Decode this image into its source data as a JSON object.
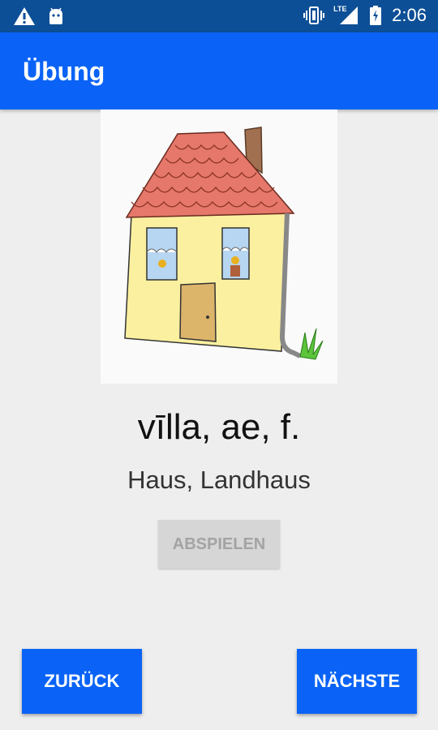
{
  "statusbar": {
    "time": "2:06",
    "network_label": "LTE",
    "icons": [
      "warning-icon",
      "android-icon",
      "vibrate-icon",
      "signal-icon",
      "battery-icon"
    ]
  },
  "appbar": {
    "title": "Übung"
  },
  "card": {
    "image": "house-illustration",
    "word": "vīlla, ae, f.",
    "meaning": "Haus, Landhaus"
  },
  "actions": {
    "play_label": "ABSPIELEN",
    "back_label": "ZURÜCK",
    "next_label": "NÄCHSTE"
  },
  "colors": {
    "primary": "#0a63f6",
    "status_bar": "#0d4f96",
    "background": "#eeeeee",
    "disabled_button": "#d6d6d6"
  }
}
